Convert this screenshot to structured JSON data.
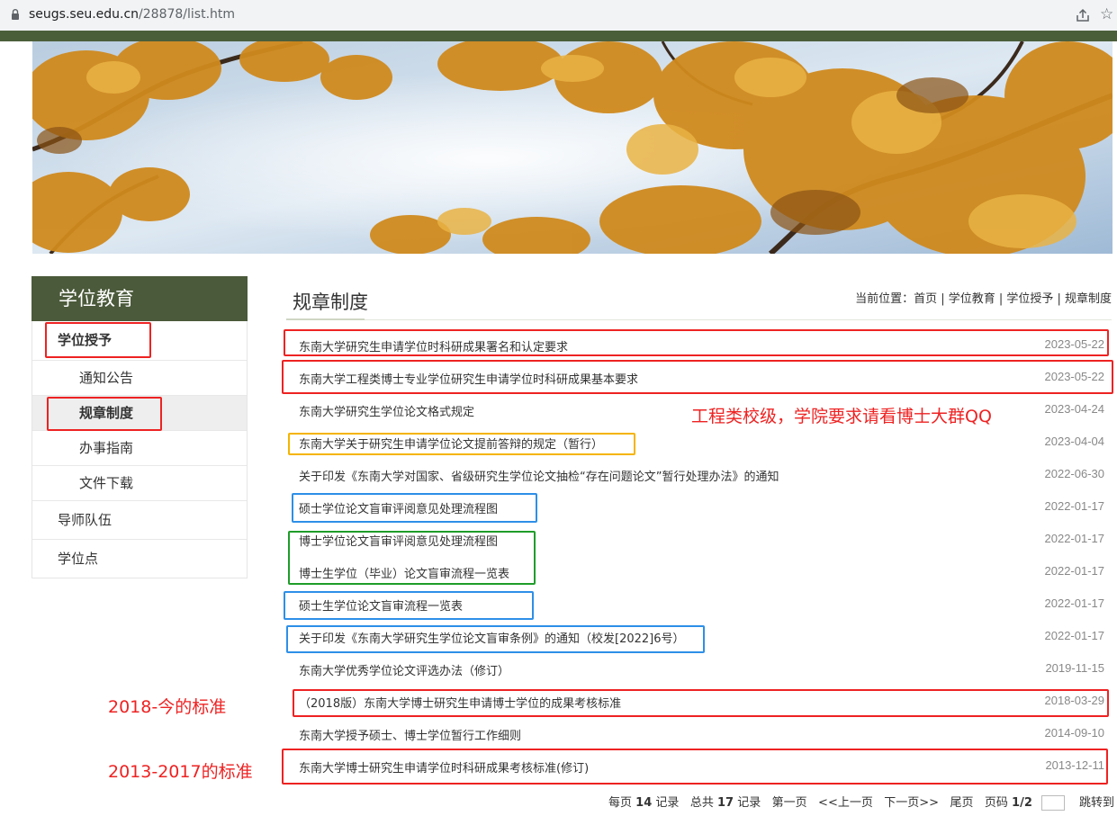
{
  "browser": {
    "url_host": "seugs.seu.edu.cn",
    "url_path": "/28878/list.htm"
  },
  "sidebar": {
    "title": "学位教育",
    "items": [
      {
        "label": "学位授予",
        "level": 1
      },
      {
        "label": "通知公告",
        "level": 2
      },
      {
        "label": "规章制度",
        "level": 2,
        "active": true
      },
      {
        "label": "办事指南",
        "level": 2
      },
      {
        "label": "文件下载",
        "level": 2
      },
      {
        "label": "导师队伍",
        "level": 1
      },
      {
        "label": "学位点",
        "level": 1
      }
    ]
  },
  "main": {
    "title": "规章制度",
    "breadcrumb": "当前位置：首页 | 学位教育 | 学位授予 | 规章制度",
    "rows": [
      {
        "title": "东南大学研究生申请学位时科研成果署名和认定要求",
        "date": "2023-05-22"
      },
      {
        "title": "东南大学工程类博士专业学位研究生申请学位时科研成果基本要求",
        "date": "2023-05-22"
      },
      {
        "title": "东南大学研究生学位论文格式规定",
        "date": "2023-04-24"
      },
      {
        "title": "东南大学关于研究生申请学位论文提前答辩的规定（暂行）",
        "date": "2023-04-04"
      },
      {
        "title": "关于印发《东南大学对国家、省级研究生学位论文抽检“存在问题论文”暂行处理办法》的通知",
        "date": "2022-06-30"
      },
      {
        "title": "硕士学位论文盲审评阅意见处理流程图",
        "date": "2022-01-17"
      },
      {
        "title": "博士学位论文盲审评阅意见处理流程图",
        "date": "2022-01-17"
      },
      {
        "title": "博士生学位（毕业）论文盲审流程一览表",
        "date": "2022-01-17"
      },
      {
        "title": "硕士生学位论文盲审流程一览表",
        "date": "2022-01-17"
      },
      {
        "title": "关于印发《东南大学研究生学位论文盲审条例》的通知（校发[2022]6号）",
        "date": "2022-01-17"
      },
      {
        "title": "东南大学优秀学位论文评选办法（修订）",
        "date": "2019-11-15"
      },
      {
        "title": "（2018版）东南大学博士研究生申请博士学位的成果考核标准",
        "date": "2018-03-29"
      },
      {
        "title": "东南大学授予硕士、博士学位暂行工作细则",
        "date": "2014-09-10"
      },
      {
        "title": "东南大学博士研究生申请学位时科研成果考核标准(修订)",
        "date": "2013-12-11"
      }
    ],
    "pagination": {
      "per_page_label": "每页",
      "per_page": "14",
      "records_label": "记录",
      "total_label": "总共",
      "total": "17",
      "first": "第一页",
      "prev": "<<上一页",
      "next": "下一页>>",
      "last": "尾页",
      "page_label": "页码",
      "page": "1/2",
      "jump": "跳转到"
    }
  },
  "annotations": {
    "note_engineering": "工程类校级，学院要求请看博士大群QQ",
    "note_2018": "2018-今的标准",
    "note_2013": "2013-2017的标准"
  },
  "colors": {
    "sidebar_header": "#4b5a3a",
    "annotation_red": "#ee2222",
    "annotation_orange": "#f5b400",
    "annotation_blue": "#2d8fe8",
    "annotation_green": "#1f9d2a"
  }
}
